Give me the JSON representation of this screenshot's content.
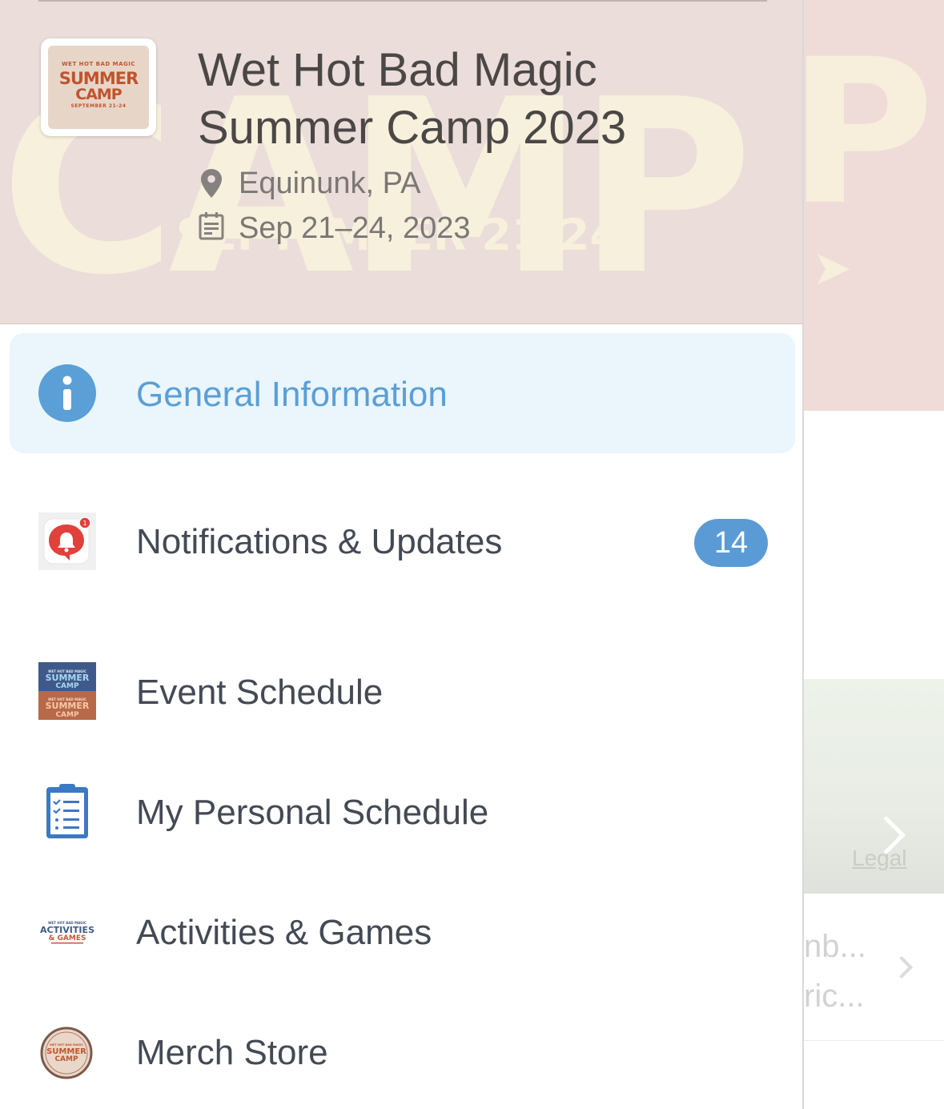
{
  "event": {
    "title": "Wet Hot Bad Magic Summer Camp 2023",
    "location": "Equinunk, PA",
    "dates": "Sep 21–24, 2023",
    "logo_lines": [
      "WET HOT BAD MAGIC",
      "SUMMER",
      "CAMP",
      "SEPTEMBER 21-24"
    ]
  },
  "menu": {
    "items": [
      {
        "label": "General Information",
        "icon": "info-icon",
        "active": true
      },
      {
        "label": "Notifications & Updates",
        "icon": "bell-icon",
        "badge": "14",
        "icon_badge": "1"
      },
      {
        "label": "Event Schedule",
        "icon": "event-schedule-logo-icon"
      },
      {
        "label": "My Personal Schedule",
        "icon": "clipboard-checklist-icon"
      },
      {
        "label": "Activities & Games",
        "icon": "activities-games-logo-icon"
      },
      {
        "label": "Merch Store",
        "icon": "merch-store-logo-icon"
      }
    ]
  },
  "background_app": {
    "legal_link": "Legal",
    "row_line_1": "nb...",
    "row_line_2": "ric..."
  },
  "colors": {
    "accent": "#5a9fd6",
    "badge": "#5b9bd5",
    "header_bg": "#ebddd9",
    "active_row_bg": "#eaf5fc",
    "bell_red": "#e0413b"
  }
}
